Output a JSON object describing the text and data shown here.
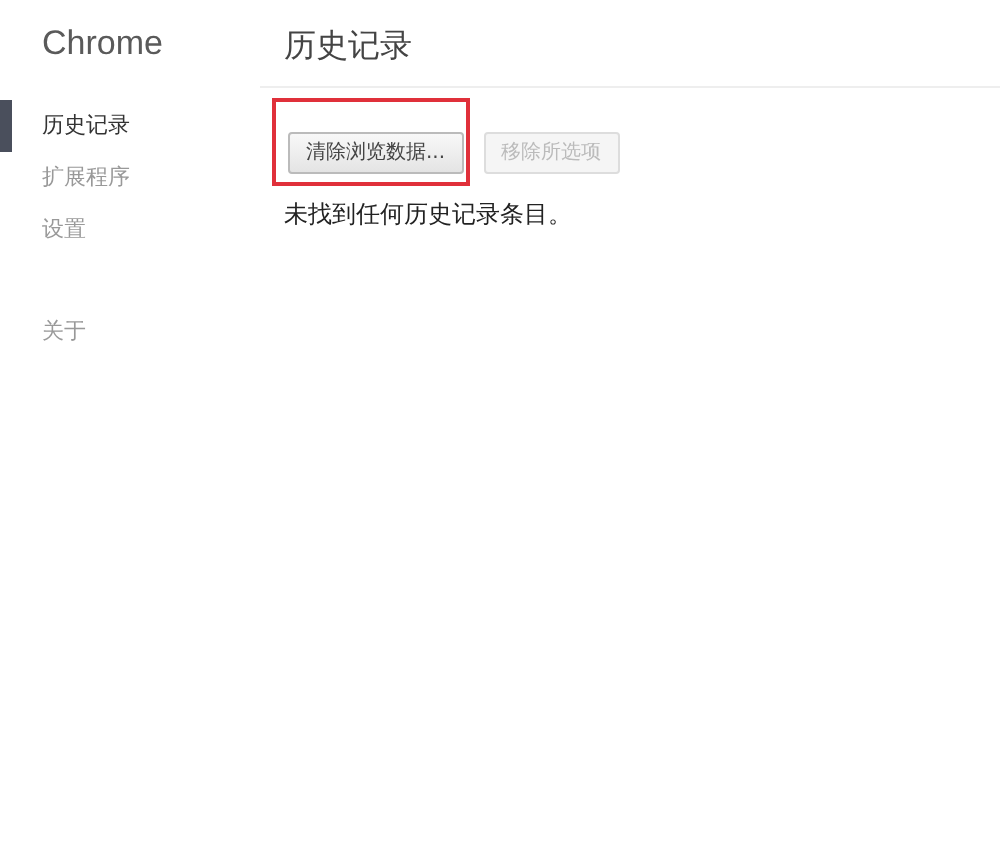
{
  "sidebar": {
    "title": "Chrome",
    "items": [
      {
        "label": "历史记录",
        "selected": true
      },
      {
        "label": "扩展程序",
        "selected": false
      },
      {
        "label": "设置",
        "selected": false
      }
    ],
    "footer_items": [
      {
        "label": "关于",
        "selected": false
      }
    ]
  },
  "main": {
    "title": "历史记录",
    "buttons": [
      {
        "label": "清除浏览数据...",
        "disabled": false,
        "highlighted": true
      },
      {
        "label": "移除所选项",
        "disabled": true,
        "highlighted": false
      }
    ],
    "message": "未找到任何历史记录条目。"
  }
}
